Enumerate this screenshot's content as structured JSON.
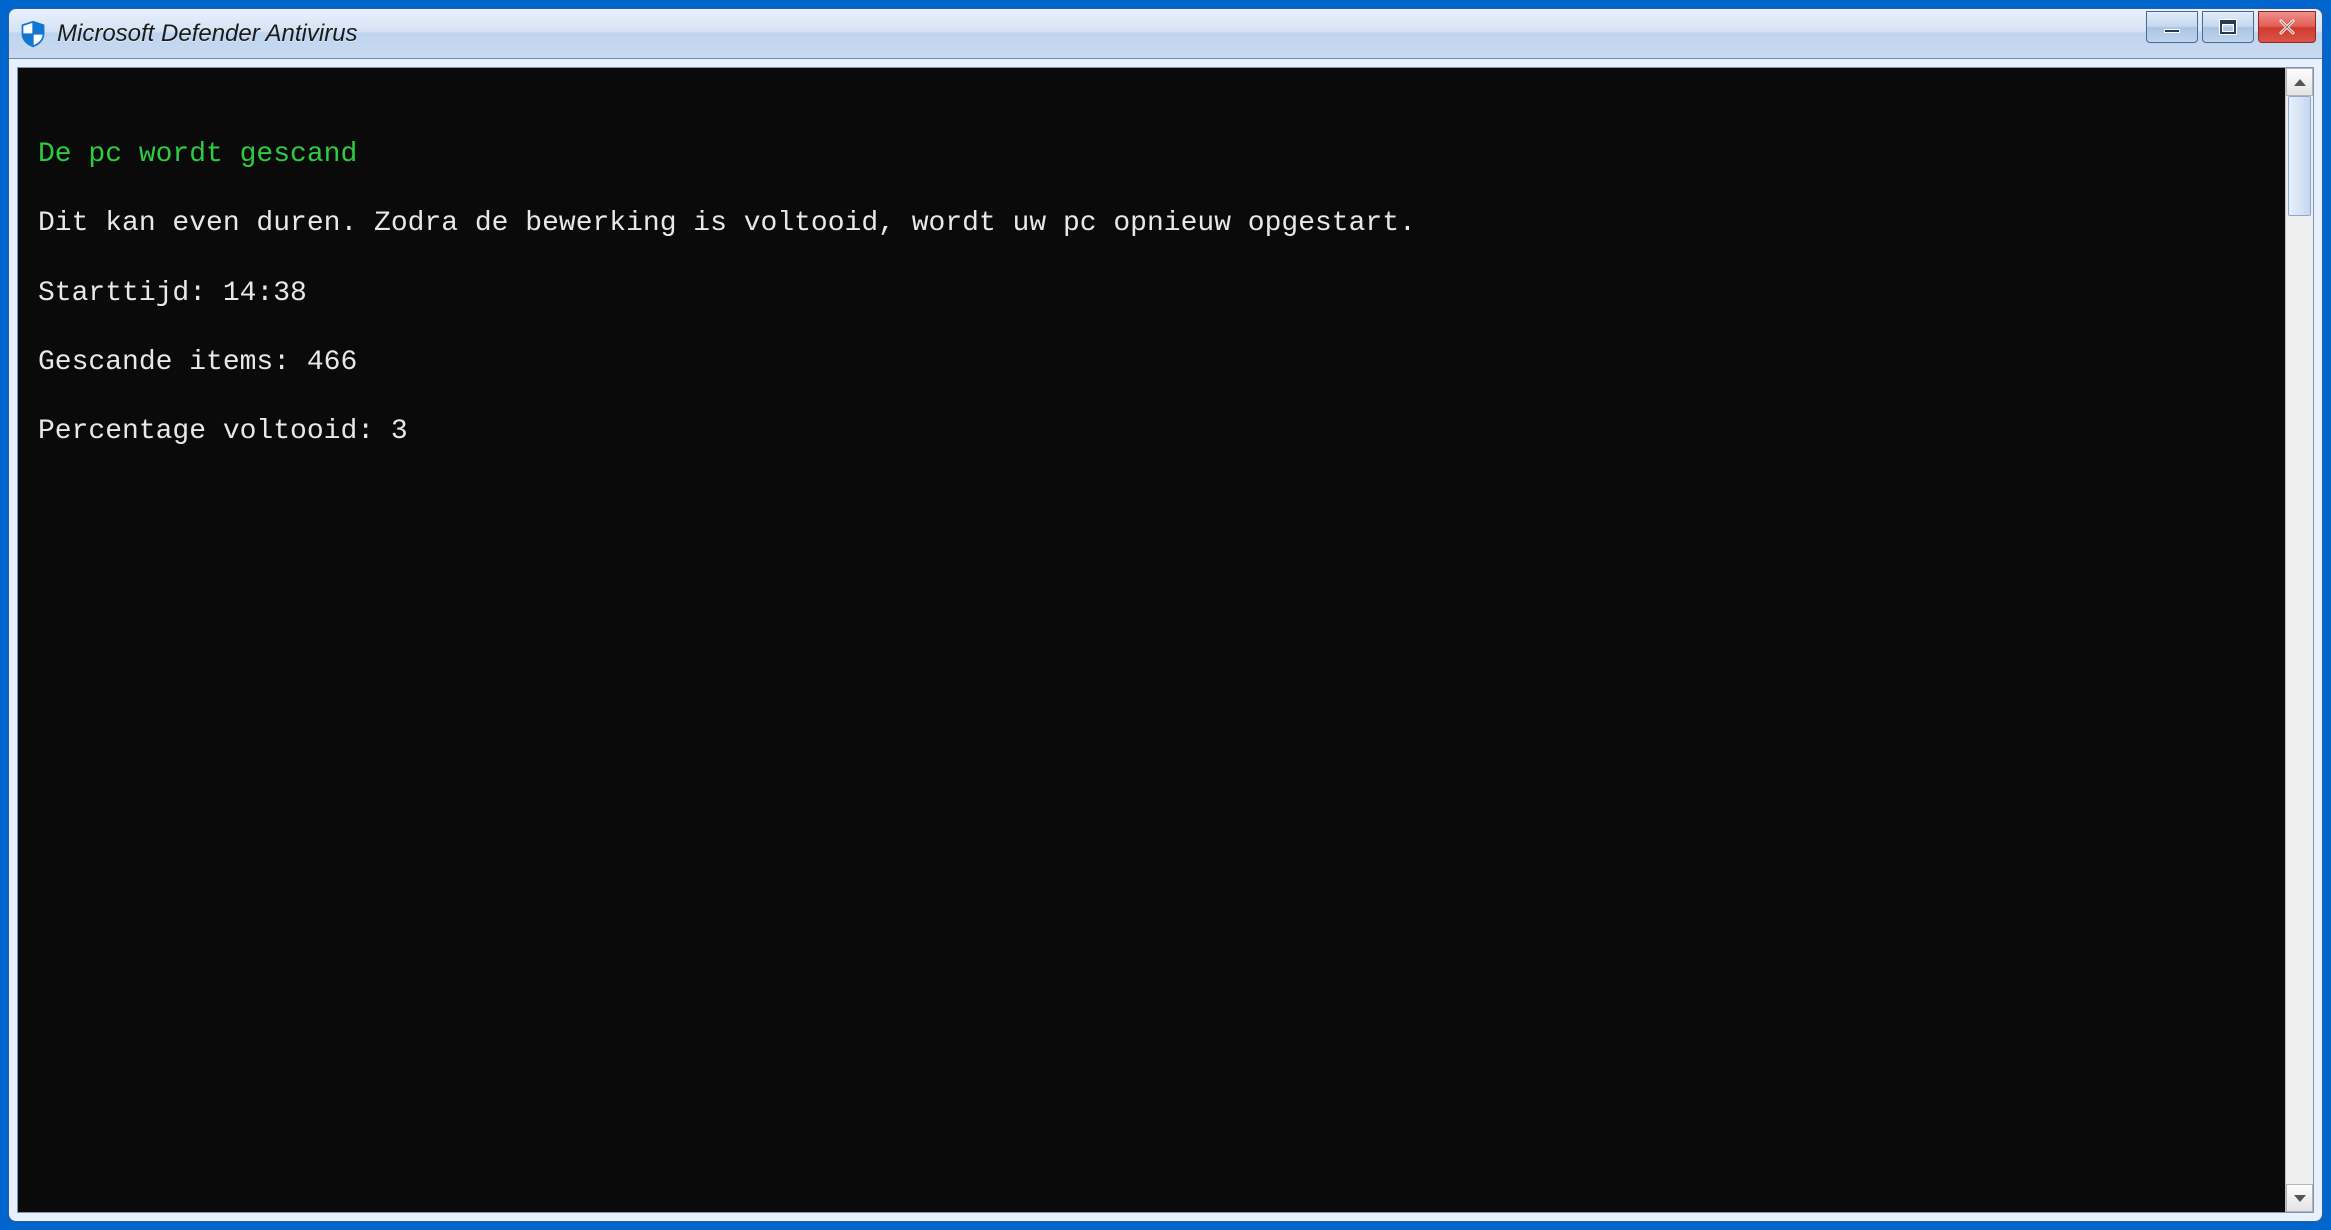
{
  "window": {
    "title": "Microsoft Defender Antivirus"
  },
  "console": {
    "heading": "De pc wordt gescand",
    "info": "Dit kan even duren. Zodra de bewerking is voltooid, wordt uw pc opnieuw opgestart.",
    "start_label": "Starttijd:",
    "start_value": "14:38",
    "scanned_label": "Gescande items:",
    "scanned_value": "466",
    "percent_label": "Percentage voltooid:",
    "percent_value": "3"
  },
  "colors": {
    "heading": "#2ecc40",
    "console_bg": "#0a0a0a",
    "console_fg": "#e8e8e8"
  }
}
